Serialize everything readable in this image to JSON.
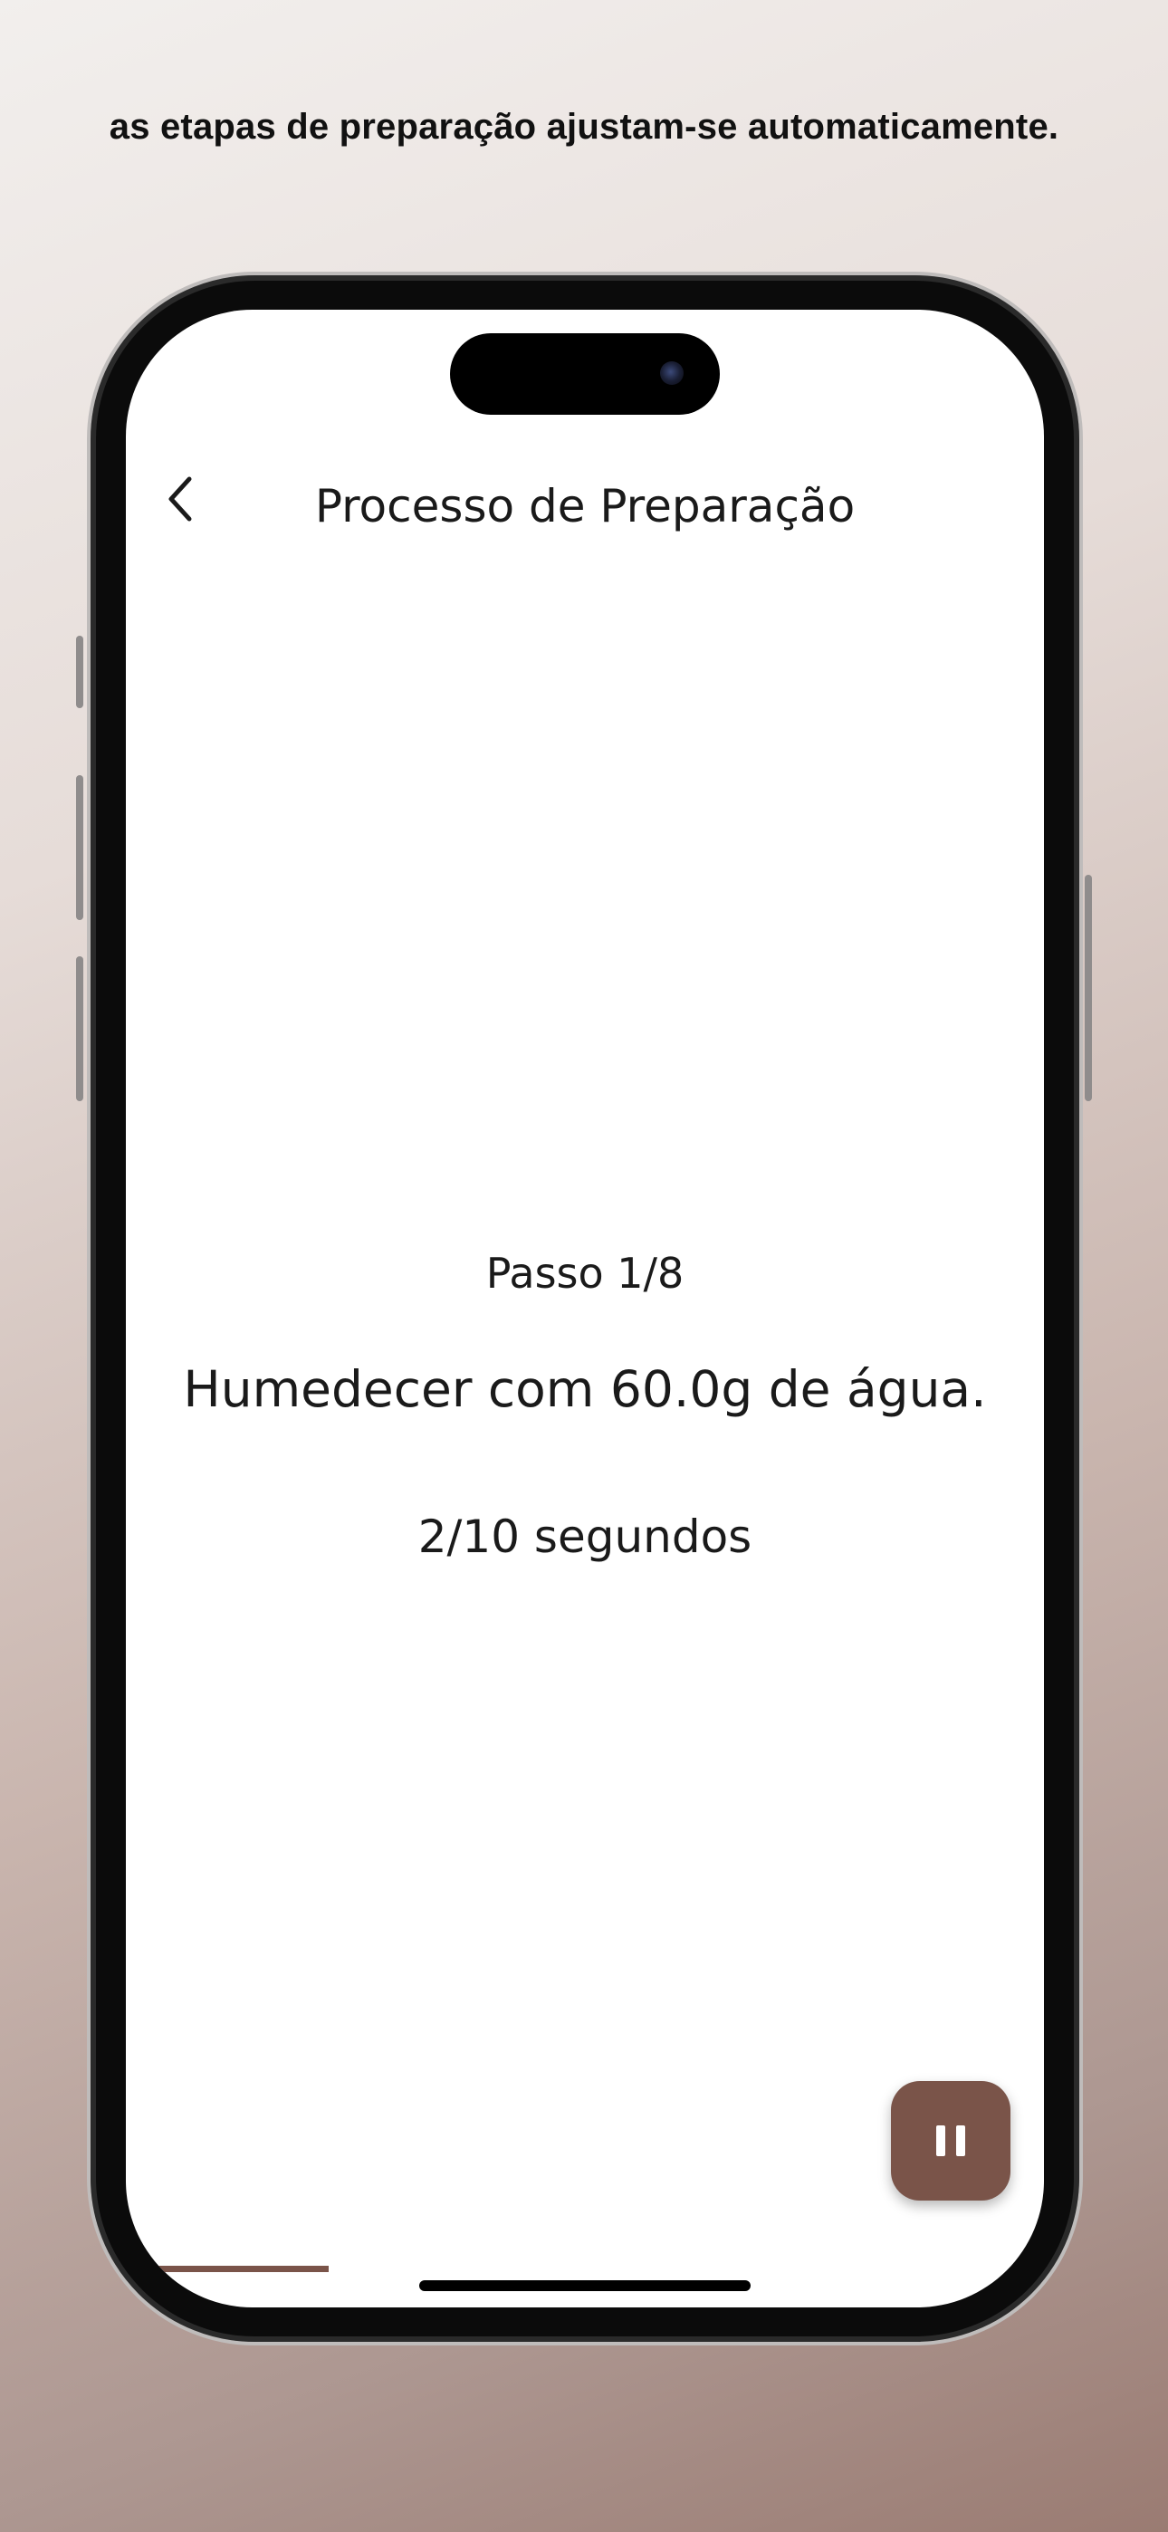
{
  "headline": "as etapas de preparação ajustam-se automaticamente.",
  "nav": {
    "title": "Processo de Preparação",
    "back_icon": "chevron-left-icon"
  },
  "step_label": "Passo 1/8",
  "instruction": "Humedecer com 60.0g de água.",
  "timer": "2/10 segundos",
  "pause_icon": "pause-icon",
  "progress": {
    "fraction": 0.125
  },
  "colors": {
    "accent": "#7a5449",
    "text": "#1a1a1a",
    "screen_bg": "#ffffff"
  }
}
